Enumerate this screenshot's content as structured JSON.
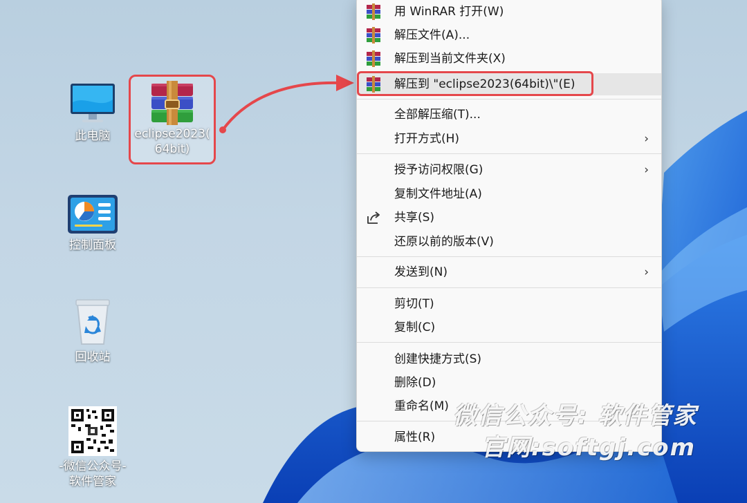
{
  "desktop": {
    "icons": [
      {
        "label": "此电脑",
        "icon": "computer-icon"
      },
      {
        "label": "eclipse2023(64bit)",
        "label_line1": "eclipse2023(",
        "label_line2": "64bit)",
        "icon": "winrar-archive-icon",
        "selected": true
      },
      {
        "label": "控制面板",
        "icon": "control-panel-icon"
      },
      {
        "label": "回收站",
        "icon": "recycle-bin-icon"
      },
      {
        "label_line1": "-微信公众号-",
        "label_line2": "软件管家",
        "icon": "qr-code-icon"
      }
    ]
  },
  "context_menu": {
    "items": [
      {
        "label": "用 WinRAR 打开(W)",
        "icon": "winrar-icon"
      },
      {
        "label": "解压文件(A)...",
        "icon": "winrar-icon"
      },
      {
        "label": "解压到当前文件夹(X)",
        "icon": "winrar-icon"
      },
      {
        "label": "解压到 \"eclipse2023(64bit)\\\"(E)",
        "icon": "winrar-icon",
        "highlighted": true
      },
      {
        "label": "全部解压缩(T)..."
      },
      {
        "label": "打开方式(H)",
        "submenu": true
      },
      {
        "label": "授予访问权限(G)",
        "submenu": true
      },
      {
        "label": "复制文件地址(A)"
      },
      {
        "label": "共享(S)",
        "icon": "share-icon"
      },
      {
        "label": "还原以前的版本(V)"
      },
      {
        "label": "发送到(N)",
        "submenu": true
      },
      {
        "label": "剪切(T)"
      },
      {
        "label": "复制(C)"
      },
      {
        "label": "创建快捷方式(S)"
      },
      {
        "label": "删除(D)"
      },
      {
        "label": "重命名(M)"
      },
      {
        "label": "属性(R)"
      }
    ],
    "submenu_arrow": "›"
  },
  "watermark": {
    "line1": "微信公众号: 软件管家",
    "line2": "官网:softgj.com"
  },
  "colors": {
    "highlight_border": "#e5474b",
    "menu_background": "#f9f9f9",
    "menu_hover": "#e6e6e6"
  }
}
